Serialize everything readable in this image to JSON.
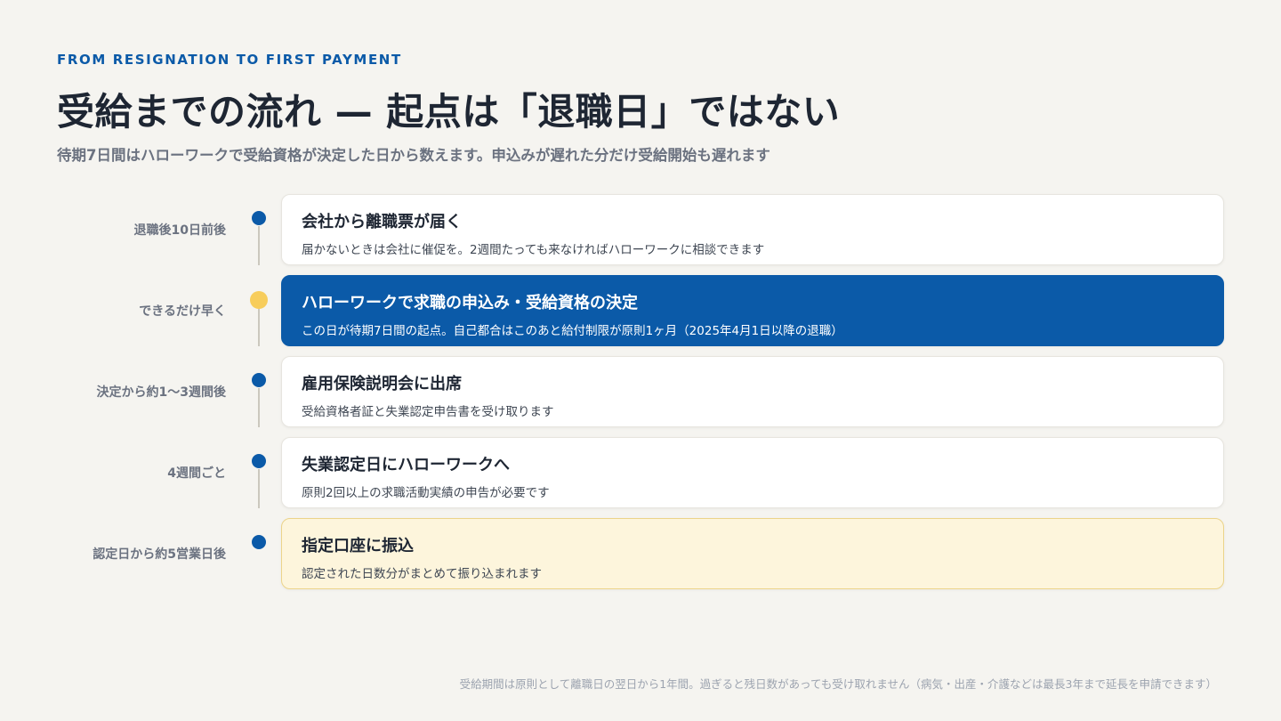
{
  "header": {
    "eyebrow": "FROM RESIGNATION TO FIRST PAYMENT",
    "title": "受給までの流れ — 起点は「退職日」ではない",
    "subtitle": "待期7日間はハローワークで受給資格が決定した日から数えます。申込みが遅れた分だけ受給開始も遅れます"
  },
  "steps": [
    {
      "timing": "退職後10日前後",
      "title": "会社から離職票が届く",
      "desc": "届かないときは会社に催促を。2週間たっても来なければハローワークに相談できます"
    },
    {
      "timing": "できるだけ早く",
      "title": "ハローワークで求職の申込み・受給資格の決定",
      "desc": "この日が待期7日間の起点。自己都合はこのあと給付制限が原則1ヶ月（2025年4月1日以降の退職）"
    },
    {
      "timing": "決定から約1〜3週間後",
      "title": "雇用保険説明会に出席",
      "desc": "受給資格者証と失業認定申告書を受け取ります"
    },
    {
      "timing": "4週間ごと",
      "title": "失業認定日にハローワークへ",
      "desc": "原則2回以上の求職活動実績の申告が必要です"
    },
    {
      "timing": "認定日から約5営業日後",
      "title": "指定口座に振込",
      "desc": "認定された日数分がまとめて振り込まれます"
    }
  ],
  "footnote": "受給期間は原則として離職日の翌日から1年間。過ぎると残日数があっても受け取れません（病気・出産・介護などは最長3年まで延長を申請できます）",
  "colors": {
    "accent": "#0b5aa8",
    "highlight_dot": "#f7cd5c",
    "highlight_card": "#fdf5dc",
    "background": "#f5f4f0"
  }
}
